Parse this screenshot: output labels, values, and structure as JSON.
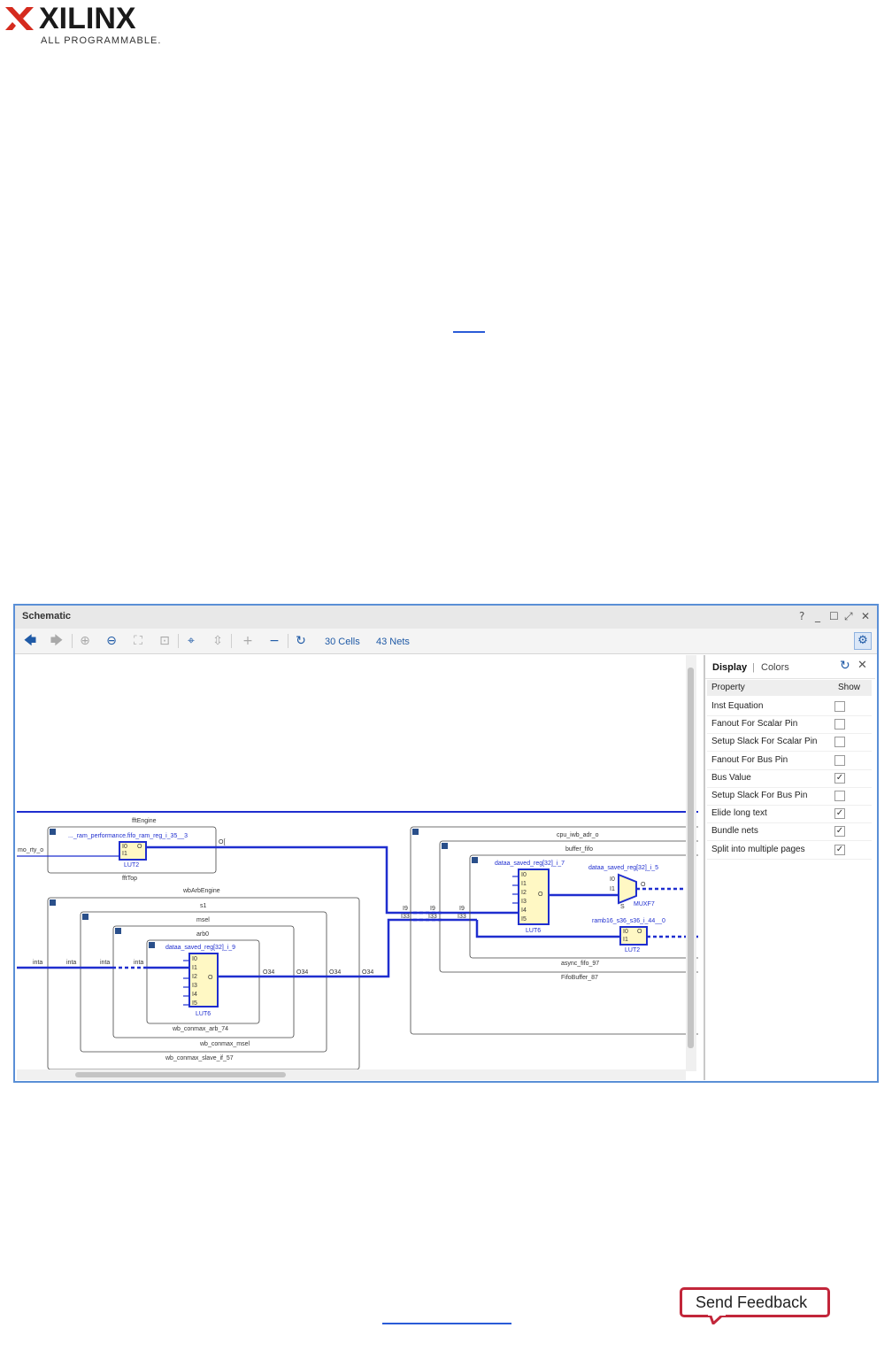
{
  "logo": {
    "brand": "XILINX",
    "tagline": "ALL PROGRAMMABLE."
  },
  "window": {
    "title": "Schematic",
    "controls": [
      "?",
      "_",
      "☐",
      "⤢",
      "✕"
    ]
  },
  "toolbar": {
    "cells_label": "30 Cells",
    "nets_label": "43 Nets"
  },
  "schematic": {
    "left_input": "mo_rty_o",
    "fftEngine": {
      "title": "fftEngine",
      "footer": "fftTop",
      "cell": {
        "name": "..._ram_performance.fifo_ram_reg_i_35__3",
        "type": "LUT2",
        "pins_in": [
          "I0",
          "I1"
        ],
        "pin_out": "O"
      },
      "out_label": "O[",
      "wire_label_1": "I9",
      "wire_label_2": "I33"
    },
    "wbArbEngine": {
      "title": "wbArbEngine",
      "s1": "s1",
      "msel": "msel",
      "arb0": "arb0",
      "cell": {
        "name": "dataa_saved_reg[32]_i_9",
        "type": "LUT6",
        "pins_in": [
          "I0",
          "I1",
          "I2",
          "I3",
          "I4",
          "I5"
        ],
        "pin_out": "O"
      },
      "footer_arb": "wb_conmax_arb_74",
      "footer_msel": "wb_conmax_msel",
      "footer_slave": "wb_conmax_slave_if_57",
      "net_labels": [
        "inta",
        "inta",
        "inta",
        "inta"
      ],
      "out_labels": [
        "O34",
        "O34",
        "O34",
        "O34"
      ]
    },
    "cpu": {
      "title": "cpu_iwb_adr_o",
      "buffer": "buffer_fifo",
      "lut6": {
        "name": "dataa_saved_reg[32]_i_7",
        "type": "LUT6",
        "pins_in": [
          "I0",
          "I1",
          "I2",
          "I3",
          "I4",
          "I5"
        ],
        "pin_out": "O"
      },
      "muxf7": {
        "name": "dataa_saved_reg[32]_i_5",
        "type": "MUXF7",
        "pins_in": [
          "I0",
          "I1"
        ],
        "pin_out": "O",
        "sel": "S"
      },
      "lut2": {
        "name": "ramb16_s36_s36_i_44__0",
        "type": "LUT2",
        "pins_in": [
          "I0",
          "I1"
        ],
        "pin_out": "O"
      },
      "footer_async": "async_fifo_97",
      "footer_fifo": "FifoBuffer_87",
      "in_labels_top": [
        "I9",
        "I9",
        "I9"
      ],
      "in_labels_bot": [
        "I33",
        "I33",
        "I33"
      ]
    }
  },
  "panel": {
    "tabs": [
      "Display",
      "Colors"
    ],
    "col_property": "Property",
    "col_show": "Show",
    "rows": [
      {
        "label": "Inst Equation",
        "checked": false
      },
      {
        "label": "Fanout For Scalar Pin",
        "checked": false
      },
      {
        "label": "Setup Slack For Scalar Pin",
        "checked": false
      },
      {
        "label": "Fanout For Bus Pin",
        "checked": false
      },
      {
        "label": "Bus Value",
        "checked": true
      },
      {
        "label": "Setup Slack For Bus Pin",
        "checked": false
      },
      {
        "label": "Elide long text",
        "checked": true
      },
      {
        "label": "Bundle nets",
        "checked": true
      },
      {
        "label": "Split into multiple pages",
        "checked": true
      }
    ]
  },
  "feedback": {
    "label": "Send Feedback"
  },
  "colors": {
    "wire": "#1f2ecf",
    "cell_fill": "#fff8c4",
    "window_border": "#5a8fd6",
    "feedback_border": "#c2263a"
  }
}
